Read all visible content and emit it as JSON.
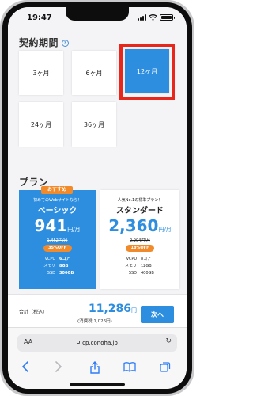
{
  "status": {
    "time": "19:47"
  },
  "contract": {
    "title": "契約期間",
    "help_icon": "question-circle-icon",
    "options": [
      "3ヶ月",
      "6ヶ月",
      "12ヶ月",
      "24ヶ月",
      "36ヶ月"
    ],
    "selected": "12ヶ月"
  },
  "plans_title": "プラン",
  "plans": [
    {
      "badge": "おすすめ",
      "catch": "初めてのWebサイトなら！",
      "name": "ベーシック",
      "price": "941",
      "unit": "円/月",
      "old_price": "1,452円/月",
      "discount": "35%OFF",
      "specs": [
        [
          "vCPU",
          "6コア"
        ],
        [
          "メモリ",
          "8GB"
        ],
        [
          "SSD",
          "300GB"
        ]
      ]
    },
    {
      "catch": "人気No.1の標準プラン！",
      "name": "スタンダード",
      "price": "2,360",
      "unit": "円/月",
      "old_price": "2,904円/月",
      "discount": "18%OFF",
      "specs": [
        [
          "vCPU",
          "8コア"
        ],
        [
          "メモリ",
          "12GB"
        ],
        [
          "SSD",
          "400GB"
        ]
      ]
    }
  ],
  "summary": {
    "total_label": "合計（税込）",
    "total": "11,286",
    "unit": "円",
    "tax_note": "(消費税 1,026円)",
    "next_label": "次へ"
  },
  "browser": {
    "aa_label": "AA",
    "url": "cp.conoha.jp",
    "icons": [
      "back-icon",
      "forward-icon",
      "share-icon",
      "bookmarks-icon",
      "tabs-icon"
    ]
  },
  "colors": {
    "accent": "#2d8ee0",
    "highlight": "#e8271c",
    "badge": "#f08a2a"
  }
}
